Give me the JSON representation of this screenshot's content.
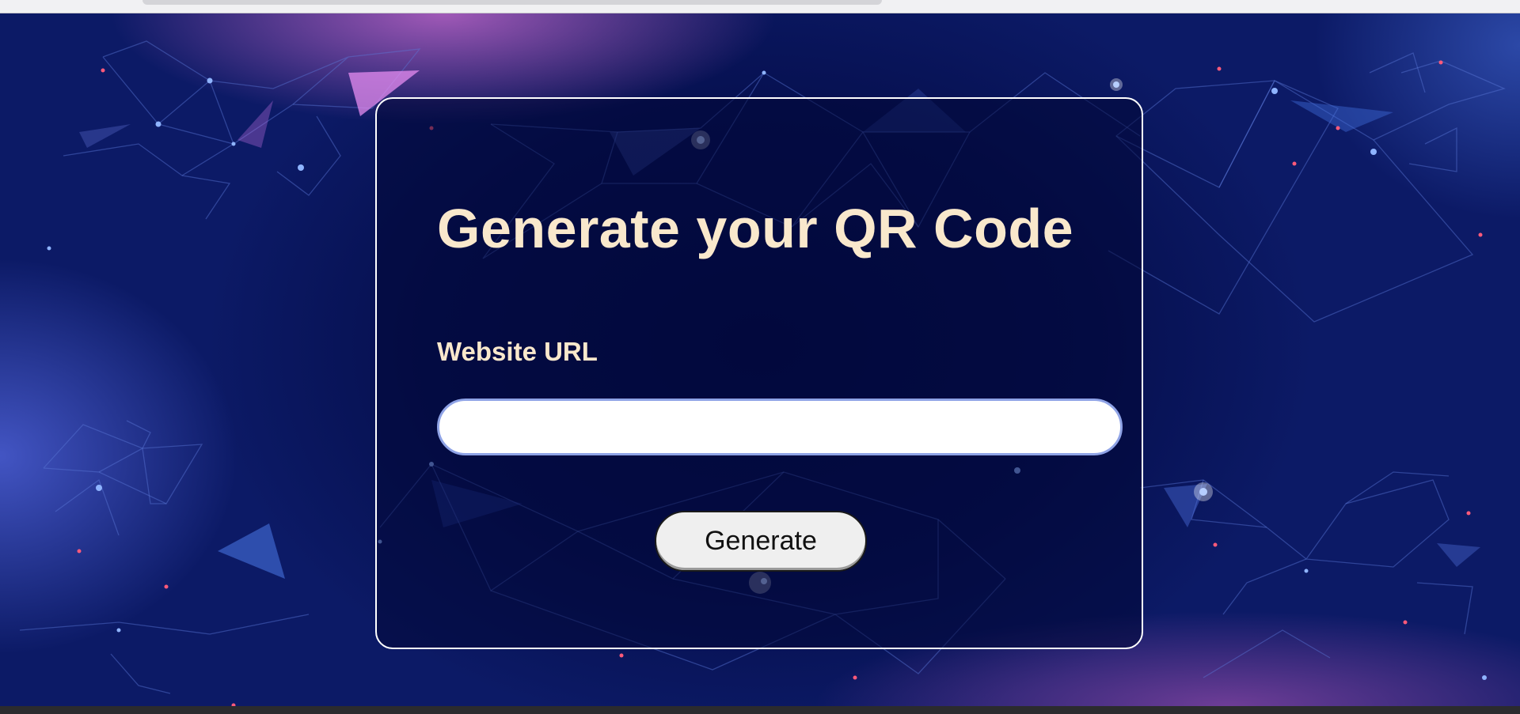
{
  "form": {
    "title": "Generate your QR Code",
    "url_label": "Website URL",
    "url_value": "",
    "url_placeholder": "",
    "generate_label": "Generate"
  },
  "colors": {
    "text_accent": "#f9e8cc",
    "background_dark": "#061050",
    "card_border": "#ffffff",
    "input_border": "#8fa3e6",
    "button_bg": "#efefef"
  }
}
